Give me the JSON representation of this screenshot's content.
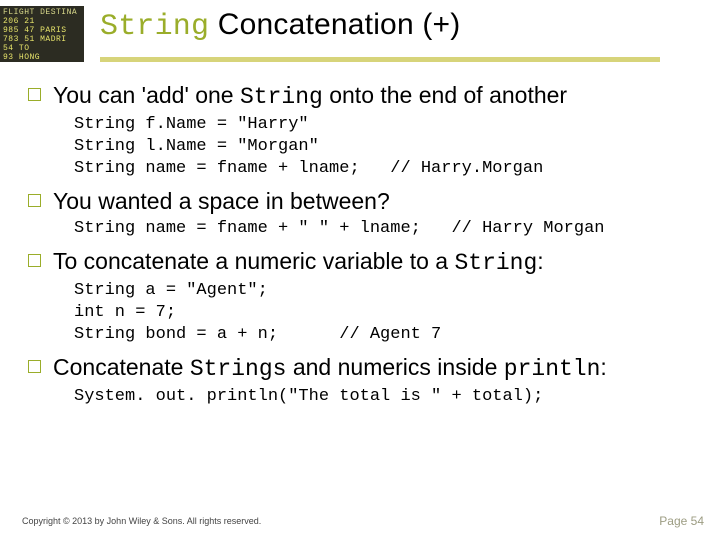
{
  "decor_board_lines": [
    "FLIGHT  DESTINA",
    " 206  21   ",
    " 985  47  PARIS",
    " 783  51  MADRI",
    " 54        TO",
    " 93        HONG"
  ],
  "title": {
    "pre": "String",
    "rest": " Concatenation (+)"
  },
  "bullets": {
    "b1": {
      "pre": "You can 'add' one ",
      "mono": "String",
      "post": " onto the end of another"
    },
    "b2": {
      "text": "You wanted a space in between?"
    },
    "b3": {
      "pre": "To concatenate a numeric variable to a ",
      "mono": "String",
      "post": ":"
    },
    "b4": {
      "pre": "Concatenate ",
      "mono1": "Strings",
      "mid": " and numerics inside ",
      "mono2": "println",
      "post": ":"
    }
  },
  "code": {
    "c1": "String f.Name = \"Harry\"\nString l.Name = \"Morgan\"\nString name = fname + lname;   // Harry.Morgan",
    "c2": "String name = fname + \" \" + lname;   // Harry Morgan",
    "c3": "String a = \"Agent\";\nint n = 7;\nString bond = a + n;      // Agent 7",
    "c4": "System. out. println(\"The total is \" + total);"
  },
  "footer": "Copyright © 2013 by John Wiley & Sons. All rights reserved.",
  "page": "Page 54"
}
